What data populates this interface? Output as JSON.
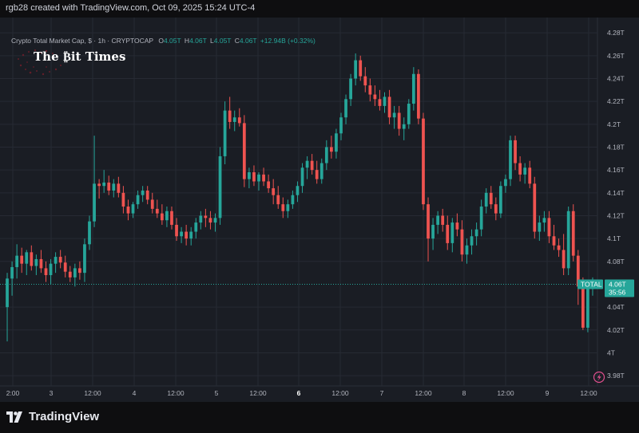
{
  "header": {
    "creator_text": "rgb28 created with TradingView.com, Oct 09, 2025 15:24 UTC-4"
  },
  "legend": {
    "symbol_title": "Crypto Total Market Cap, $ · 1h · CRYPTOCAP",
    "open_label": "O",
    "open_value": "4.05T",
    "high_label": "H",
    "high_value": "4.06T",
    "low_label": "L",
    "low_value": "4.05T",
    "close_label": "C",
    "close_value": "4.06T",
    "change_value": "+12.94B (+0.32%)"
  },
  "watermark": {
    "text": "The ₿it Times"
  },
  "price_tag": {
    "symbol": "TOTAL",
    "price": "4.06T",
    "countdown": "35:56"
  },
  "footer": {
    "brand": "TradingView"
  },
  "colors": {
    "up": "#26a69a",
    "down": "#ef5350",
    "background": "#1a1d24",
    "grid": "#262a33",
    "axis_text": "#b2b5be"
  },
  "chart_data": {
    "type": "candlestick",
    "interval": "1h",
    "x_tick_labels": [
      "2:00",
      "3",
      "12:00",
      "4",
      "12:00",
      "5",
      "12:00",
      "6",
      "12:00",
      "7",
      "12:00",
      "8",
      "12:00",
      "9",
      "12:00"
    ],
    "y_tick_labels": [
      "4.28T",
      "4.26T",
      "4.24T",
      "4.22T",
      "4.2T",
      "4.18T",
      "4.16T",
      "4.14T",
      "4.12T",
      "4.1T",
      "4.08T",
      "4.04T",
      "4.02T",
      "4T",
      "3.98T"
    ],
    "ylim": [
      3.978,
      4.285
    ],
    "current_price": 4.06,
    "ohlc": [
      [
        4.04,
        4.07,
        4.01,
        4.065
      ],
      [
        4.065,
        4.08,
        4.05,
        4.075
      ],
      [
        4.075,
        4.095,
        4.065,
        4.085
      ],
      [
        4.085,
        4.092,
        4.07,
        4.078
      ],
      [
        4.078,
        4.09,
        4.068,
        4.088
      ],
      [
        4.088,
        4.094,
        4.072,
        4.076
      ],
      [
        4.076,
        4.086,
        4.068,
        4.082
      ],
      [
        4.082,
        4.09,
        4.07,
        4.074
      ],
      [
        4.074,
        4.08,
        4.062,
        4.068
      ],
      [
        4.068,
        4.082,
        4.06,
        4.078
      ],
      [
        4.078,
        4.088,
        4.07,
        4.084
      ],
      [
        4.084,
        4.09,
        4.074,
        4.079
      ],
      [
        4.079,
        4.085,
        4.066,
        4.071
      ],
      [
        4.071,
        4.076,
        4.062,
        4.066
      ],
      [
        4.066,
        4.078,
        4.058,
        4.074
      ],
      [
        4.074,
        4.08,
        4.064,
        4.07
      ],
      [
        4.07,
        4.1,
        4.062,
        4.095
      ],
      [
        4.095,
        4.12,
        4.09,
        4.115
      ],
      [
        4.115,
        4.19,
        4.11,
        4.148
      ],
      [
        4.148,
        4.152,
        4.135,
        4.146
      ],
      [
        4.146,
        4.16,
        4.14,
        4.149
      ],
      [
        4.149,
        4.155,
        4.138,
        4.142
      ],
      [
        4.142,
        4.152,
        4.136,
        4.148
      ],
      [
        4.148,
        4.154,
        4.136,
        4.14
      ],
      [
        4.14,
        4.146,
        4.122,
        4.128
      ],
      [
        4.128,
        4.134,
        4.116,
        4.122
      ],
      [
        4.122,
        4.132,
        4.118,
        4.13
      ],
      [
        4.13,
        4.142,
        4.126,
        4.138
      ],
      [
        4.138,
        4.146,
        4.132,
        4.142
      ],
      [
        4.142,
        4.146,
        4.13,
        4.134
      ],
      [
        4.134,
        4.14,
        4.122,
        4.126
      ],
      [
        4.126,
        4.134,
        4.118,
        4.122
      ],
      [
        4.122,
        4.13,
        4.112,
        4.116
      ],
      [
        4.116,
        4.128,
        4.11,
        4.124
      ],
      [
        4.124,
        4.128,
        4.108,
        4.112
      ],
      [
        4.112,
        4.118,
        4.098,
        4.102
      ],
      [
        4.102,
        4.11,
        4.096,
        4.106
      ],
      [
        4.106,
        4.112,
        4.094,
        4.1
      ],
      [
        4.1,
        4.11,
        4.094,
        4.106
      ],
      [
        4.106,
        4.118,
        4.1,
        4.114
      ],
      [
        4.114,
        4.124,
        4.108,
        4.12
      ],
      [
        4.12,
        4.126,
        4.11,
        4.118
      ],
      [
        4.118,
        4.124,
        4.108,
        4.114
      ],
      [
        4.114,
        4.122,
        4.106,
        4.118
      ],
      [
        4.118,
        4.18,
        4.112,
        4.172
      ],
      [
        4.172,
        4.22,
        4.165,
        4.212
      ],
      [
        4.212,
        4.224,
        4.196,
        4.202
      ],
      [
        4.202,
        4.212,
        4.194,
        4.206
      ],
      [
        4.206,
        4.214,
        4.198,
        4.201
      ],
      [
        4.201,
        4.208,
        4.145,
        4.152
      ],
      [
        4.152,
        4.162,
        4.144,
        4.158
      ],
      [
        4.158,
        4.164,
        4.146,
        4.15
      ],
      [
        4.15,
        4.158,
        4.142,
        4.156
      ],
      [
        4.156,
        4.162,
        4.146,
        4.15
      ],
      [
        4.15,
        4.156,
        4.14,
        4.144
      ],
      [
        4.144,
        4.152,
        4.13,
        4.138
      ],
      [
        4.138,
        4.146,
        4.126,
        4.13
      ],
      [
        4.13,
        4.136,
        4.118,
        4.124
      ],
      [
        4.124,
        4.134,
        4.118,
        4.13
      ],
      [
        4.13,
        4.142,
        4.126,
        4.138
      ],
      [
        4.138,
        4.15,
        4.132,
        4.146
      ],
      [
        4.146,
        4.166,
        4.14,
        4.162
      ],
      [
        4.162,
        4.172,
        4.152,
        4.168
      ],
      [
        4.168,
        4.174,
        4.156,
        4.16
      ],
      [
        4.16,
        4.168,
        4.148,
        4.152
      ],
      [
        4.152,
        4.17,
        4.148,
        4.166
      ],
      [
        4.166,
        4.186,
        4.16,
        4.18
      ],
      [
        4.18,
        4.19,
        4.17,
        4.176
      ],
      [
        4.176,
        4.196,
        4.17,
        4.192
      ],
      [
        4.192,
        4.21,
        4.186,
        4.206
      ],
      [
        4.206,
        4.226,
        4.2,
        4.222
      ],
      [
        4.222,
        4.244,
        4.216,
        4.24
      ],
      [
        4.24,
        4.262,
        4.234,
        4.256
      ],
      [
        4.256,
        4.26,
        4.238,
        4.242
      ],
      [
        4.242,
        4.25,
        4.228,
        4.234
      ],
      [
        4.234,
        4.24,
        4.22,
        4.226
      ],
      [
        4.226,
        4.234,
        4.216,
        4.222
      ],
      [
        4.222,
        4.23,
        4.212,
        4.216
      ],
      [
        4.216,
        4.228,
        4.21,
        4.224
      ],
      [
        4.224,
        4.23,
        4.2,
        4.206
      ],
      [
        4.206,
        4.216,
        4.196,
        4.21
      ],
      [
        4.21,
        4.216,
        4.19,
        4.196
      ],
      [
        4.196,
        4.206,
        4.186,
        4.2
      ],
      [
        4.2,
        4.222,
        4.196,
        4.218
      ],
      [
        4.218,
        4.25,
        4.212,
        4.244
      ],
      [
        4.244,
        4.248,
        4.2,
        4.205
      ],
      [
        4.205,
        4.21,
        4.125,
        4.13
      ],
      [
        4.13,
        4.136,
        4.08,
        4.1
      ],
      [
        4.1,
        4.118,
        4.09,
        4.112
      ],
      [
        4.112,
        4.124,
        4.104,
        4.12
      ],
      [
        4.12,
        4.126,
        4.106,
        4.112
      ],
      [
        4.112,
        4.12,
        4.09,
        4.096
      ],
      [
        4.096,
        4.118,
        4.088,
        4.114
      ],
      [
        4.114,
        4.122,
        4.102,
        4.108
      ],
      [
        4.108,
        4.116,
        4.08,
        4.086
      ],
      [
        4.086,
        4.1,
        4.078,
        4.094
      ],
      [
        4.094,
        4.108,
        4.086,
        4.102
      ],
      [
        4.102,
        4.114,
        4.094,
        4.108
      ],
      [
        4.108,
        4.134,
        4.102,
        4.128
      ],
      [
        4.128,
        4.144,
        4.122,
        4.14
      ],
      [
        4.14,
        4.146,
        4.126,
        4.13
      ],
      [
        4.13,
        4.136,
        4.116,
        4.122
      ],
      [
        4.122,
        4.15,
        4.118,
        4.146
      ],
      [
        4.146,
        4.156,
        4.14,
        4.152
      ],
      [
        4.152,
        4.19,
        4.146,
        4.186
      ],
      [
        4.186,
        4.19,
        4.16,
        4.166
      ],
      [
        4.166,
        4.172,
        4.15,
        4.156
      ],
      [
        4.156,
        4.166,
        4.148,
        4.162
      ],
      [
        4.162,
        4.168,
        4.144,
        4.148
      ],
      [
        4.148,
        4.154,
        4.1,
        4.106
      ],
      [
        4.106,
        4.12,
        4.098,
        4.114
      ],
      [
        4.114,
        4.124,
        4.106,
        4.118
      ],
      [
        4.118,
        4.124,
        4.096,
        4.102
      ],
      [
        4.102,
        4.112,
        4.09,
        4.094
      ],
      [
        4.094,
        4.1,
        4.084,
        4.09
      ],
      [
        4.09,
        4.104,
        4.068,
        4.074
      ],
      [
        4.074,
        4.128,
        4.068,
        4.124
      ],
      [
        4.124,
        4.13,
        4.08,
        4.085
      ],
      [
        4.085,
        4.09,
        4.042,
        4.058
      ],
      [
        4.058,
        4.066,
        4.02,
        4.022
      ],
      [
        4.022,
        4.062,
        4.018,
        4.056
      ],
      [
        4.056,
        4.066,
        4.05,
        4.062
      ]
    ]
  }
}
